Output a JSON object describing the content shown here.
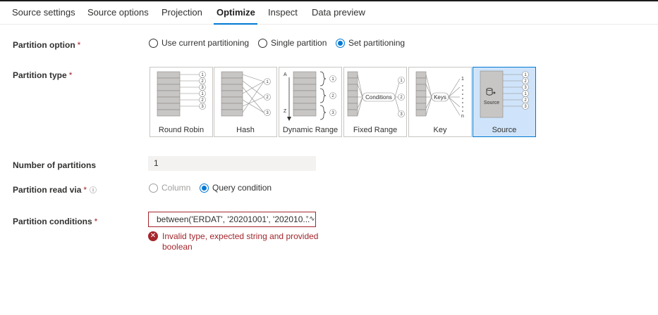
{
  "tabs": [
    "Source settings",
    "Source options",
    "Projection",
    "Optimize",
    "Inspect",
    "Data preview"
  ],
  "active_tab": "Optimize",
  "partition_option": {
    "label": "Partition option",
    "required_mark": "*",
    "options": [
      "Use current partitioning",
      "Single partition",
      "Set partitioning"
    ],
    "selected": "Set partitioning"
  },
  "partition_type": {
    "label": "Partition type",
    "required_mark": "*",
    "cards": [
      "Round Robin",
      "Hash",
      "Dynamic Range",
      "Fixed Range",
      "Key",
      "Source"
    ],
    "selected": "Source",
    "diagram_text": {
      "n1": "1",
      "n2": "2",
      "n3": "3",
      "a": "A",
      "z": "Z",
      "conditions": "Conditions",
      "keys": "Keys",
      "n": "n",
      "source": "Source"
    }
  },
  "number_of_partitions": {
    "label": "Number of partitions",
    "value": "1"
  },
  "partition_read_via": {
    "label": "Partition read via",
    "required_mark": "*",
    "info_icon": "info-icon",
    "options": [
      "Column",
      "Query condition"
    ],
    "selected": "Query condition",
    "disabled_option": "Column"
  },
  "partition_conditions": {
    "label": "Partition conditions",
    "required_mark": "*",
    "value": "between('ERDAT', '20201001', '202010...",
    "error": "Invalid type, expected string and provided boolean",
    "error_icon": "error-icon"
  },
  "colors": {
    "accent": "#0078d4",
    "error": "#a4262c",
    "selected_card": "#cfe4fa"
  }
}
